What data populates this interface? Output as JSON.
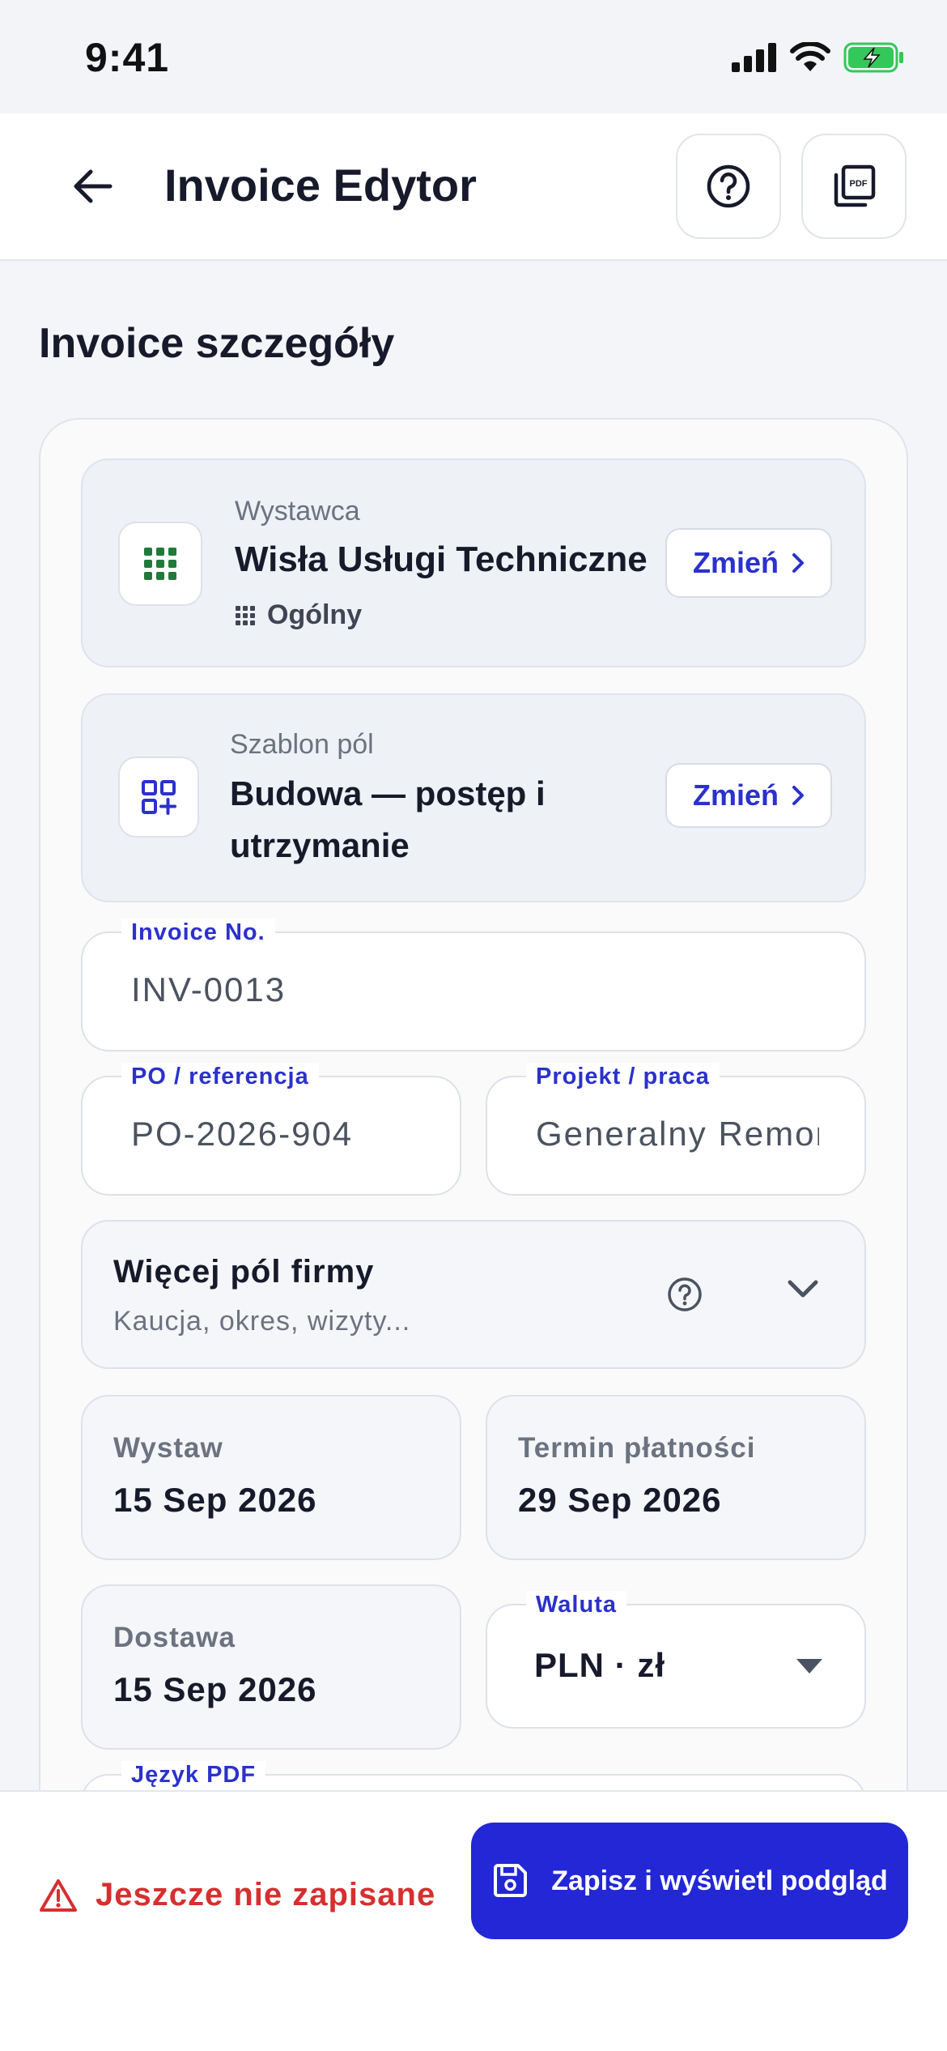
{
  "status_bar": {
    "time": "9:41"
  },
  "header": {
    "title": "Invoice Edytor"
  },
  "section": {
    "title": "Invoice szczegóły"
  },
  "issuer": {
    "label": "Wystawca",
    "name": "Wisła Usługi Techniczne",
    "category": "Ogólny",
    "change_label": "Zmień"
  },
  "template": {
    "label": "Szablon pól",
    "name_line1": "Budowa — postęp i",
    "name_line2": "utrzymanie",
    "change_label": "Zmień"
  },
  "fields": {
    "invoice_no": {
      "label": "Invoice No.",
      "value": "INV-0013"
    },
    "po_ref": {
      "label": "PO / referencja",
      "value": "PO-2026-904"
    },
    "project": {
      "label": "Projekt / praca",
      "value": "Generalny Remont"
    }
  },
  "more_fields": {
    "title": "Więcej pól firmy",
    "subtitle": "Kaucja, okres, wizyty..."
  },
  "dates": {
    "issue": {
      "label": "Wystaw",
      "value": "15 Sep 2026"
    },
    "due": {
      "label": "Termin płatności",
      "value": "29 Sep 2026"
    },
    "delivery": {
      "label": "Dostawa",
      "value": "15 Sep 2026"
    }
  },
  "currency": {
    "label": "Waluta",
    "value": "PLN · zł"
  },
  "pdf_language": {
    "label": "Język PDF"
  },
  "footer": {
    "unsaved_text": "Jeszcze nie zapisane",
    "save_label": "Zapisz i wyświetl podgląd"
  },
  "colors": {
    "accent": "#2327d6",
    "accent_text": "#2b31cc",
    "danger": "#d62f2f",
    "issuer_icon": "#1f7a3a",
    "battery": "#34c759"
  },
  "icons": {
    "back": "arrow-left-icon",
    "help": "question-circle-icon",
    "pdf": "pdf-file-icon",
    "issuer": "grid-icon",
    "template": "qr-add-icon",
    "warning": "warning-triangle-icon",
    "save": "floppy-disk-icon"
  }
}
